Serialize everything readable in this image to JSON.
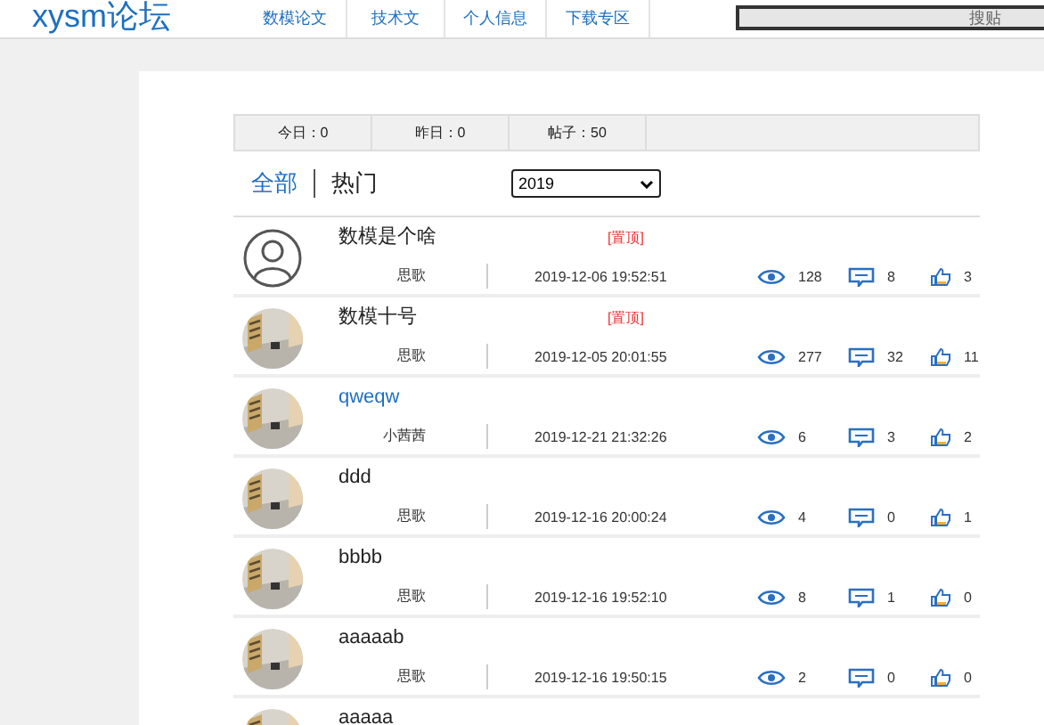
{
  "header": {
    "logo": "xysm论坛",
    "nav": [
      {
        "label": "数模论文"
      },
      {
        "label": "技术文"
      },
      {
        "label": "个人信息"
      },
      {
        "label": "下载专区"
      }
    ],
    "search": {
      "placeholder": "搜贴"
    }
  },
  "stats": [
    {
      "label": "今日：0"
    },
    {
      "label": "昨日：0"
    },
    {
      "label": "帖子：50"
    }
  ],
  "filter_tabs": [
    {
      "label": "全部",
      "selected": true
    },
    {
      "label": "热门",
      "selected": false
    }
  ],
  "year_select": {
    "value": "2019"
  },
  "posts": [
    {
      "kind": "default",
      "title": "数模是个啥",
      "highlighted": false,
      "pinned_tag": "[置顶]",
      "author": "思歌",
      "time": "2019-12-06 19:52:51",
      "views": "128",
      "comments": "8",
      "likes": "3"
    },
    {
      "kind": "picture",
      "title": "数模十号",
      "highlighted": false,
      "pinned_tag": "[置顶]",
      "author": "思歌",
      "time": "2019-12-05 20:01:55",
      "views": "277",
      "comments": "32",
      "likes": "11"
    },
    {
      "kind": "picture",
      "title": "qweqw",
      "highlighted": true,
      "author": "小茜茜",
      "time": "2019-12-21 21:32:26",
      "views": "6",
      "comments": "3",
      "likes": "2"
    },
    {
      "kind": "picture",
      "title": "ddd",
      "highlighted": false,
      "author": "思歌",
      "time": "2019-12-16 20:00:24",
      "views": "4",
      "comments": "0",
      "likes": "1"
    },
    {
      "kind": "picture",
      "title": "bbbb",
      "highlighted": false,
      "author": "思歌",
      "time": "2019-12-16 19:52:10",
      "views": "8",
      "comments": "1",
      "likes": "0"
    },
    {
      "kind": "picture",
      "title": "aaaaab",
      "highlighted": false,
      "author": "思歌",
      "time": "2019-12-16 19:50:15",
      "views": "2",
      "comments": "0",
      "likes": "0"
    },
    {
      "kind": "picture",
      "title": "aaaaa",
      "highlighted": false
    }
  ]
}
